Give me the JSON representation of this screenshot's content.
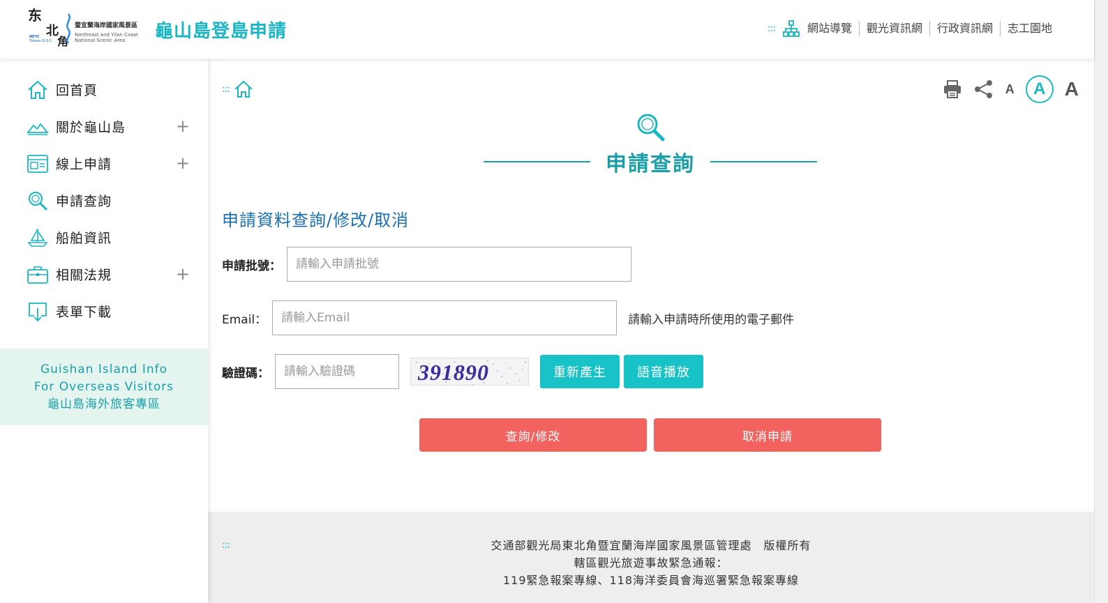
{
  "header": {
    "logo_mark": [
      "东",
      "北",
      "角"
    ],
    "logo_text": "暨宜蘭海岸國家風景區",
    "logo_sub_1": "Northeast and Yilan Coast",
    "logo_sub_2": "National Scenic Area",
    "logo_tiny_1": "NEYC",
    "logo_tiny_2": "Taiwan R.O.C.",
    "site_title": "龜山島登島申請",
    "nav_dots": ":::",
    "nav": [
      "網站導覽",
      "觀光資訊網",
      "行政資訊網",
      "志工園地"
    ]
  },
  "sidebar": {
    "items": [
      {
        "label": "回首頁",
        "icon": "home-icon",
        "expandable": false
      },
      {
        "label": "關於龜山島",
        "icon": "mountain-icon",
        "expandable": true
      },
      {
        "label": "線上申請",
        "icon": "window-form-icon",
        "expandable": true
      },
      {
        "label": "申請查詢",
        "icon": "search-icon",
        "expandable": false
      },
      {
        "label": "船舶資訊",
        "icon": "boat-icon",
        "expandable": false
      },
      {
        "label": "相關法規",
        "icon": "briefcase-icon",
        "expandable": true
      },
      {
        "label": "表單下載",
        "icon": "download-icon",
        "expandable": false
      }
    ],
    "plus": "+",
    "overseas": [
      "Guishan Island Info",
      "For Overseas Visitors",
      "龜山島海外旅客專區"
    ]
  },
  "main": {
    "breadcrumb_dots": ":::",
    "font_sizes": [
      "A",
      "A",
      "A"
    ],
    "heading": "申請查詢",
    "sub_title": "申請資料查詢/修改/取消",
    "form": {
      "batch_label": "申請批號：",
      "batch_placeholder": "請輸入申請批號",
      "email_label": "Email：",
      "email_placeholder": "請輸入Email",
      "email_hint": "請輸入申請時所使用的電子郵件",
      "captcha_label": "驗證碼：",
      "captcha_placeholder": "請輸入驗證碼",
      "captcha_value": "391890",
      "regenerate_button": "重新產生",
      "audio_button": "語音播放",
      "query_button": "查詢/修改",
      "cancel_button": "取消申請"
    }
  },
  "footer": {
    "dots": ":::",
    "lines": [
      "交通部觀光局東北角暨宜蘭海岸國家風景區管理處　版權所有",
      "轄區觀光旅遊事故緊急通報：",
      "119緊急報案專線、118海洋委員會海巡署緊急報案專線"
    ]
  },
  "colors": {
    "accent": "#1ab6c4",
    "heading": "#1a9fa8",
    "subtitle": "#1a6fb0",
    "teal_button": "#17c3c7",
    "red_button": "#f2625e",
    "overseas_bg": "#e4f4ee"
  }
}
